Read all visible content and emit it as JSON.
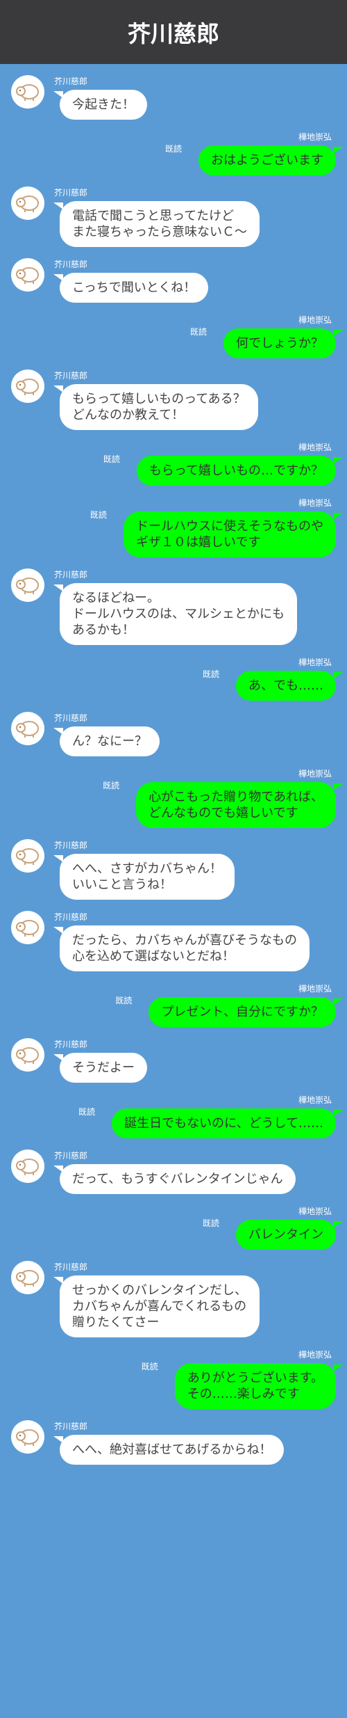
{
  "header": {
    "title": "芥川慈郎"
  },
  "read_label": "既読",
  "messages": [
    {
      "side": "left",
      "sender": "芥川慈郎",
      "text": "今起きた！"
    },
    {
      "side": "right",
      "sender": "樺地崇弘",
      "text": "おはようございます"
    },
    {
      "side": "left",
      "sender": "芥川慈郎",
      "text": "電話で聞こうと思ってたけど\nまた寝ちゃったら意味ないＣ〜"
    },
    {
      "side": "left",
      "sender": "芥川慈郎",
      "text": "こっちで聞いとくね！"
    },
    {
      "side": "right",
      "sender": "樺地崇弘",
      "text": "何でしょうか？"
    },
    {
      "side": "left",
      "sender": "芥川慈郎",
      "text": "もらって嬉しいものってある？\nどんなのか教えて！"
    },
    {
      "side": "right",
      "sender": "樺地崇弘",
      "text": "もらって嬉しいもの…ですか？"
    },
    {
      "side": "right",
      "sender": "樺地崇弘",
      "text": "ドールハウスに使えそうなものや\nギザ１０は嬉しいです"
    },
    {
      "side": "left",
      "sender": "芥川慈郎",
      "text": "なるほどねー。\nドールハウスのは、マルシェとかにも\nあるかも！"
    },
    {
      "side": "right",
      "sender": "樺地崇弘",
      "text": "あ、でも……"
    },
    {
      "side": "left",
      "sender": "芥川慈郎",
      "text": "ん？なにー？"
    },
    {
      "side": "right",
      "sender": "樺地崇弘",
      "text": "心がこもった贈り物であれば、\nどんなものでも嬉しいです"
    },
    {
      "side": "left",
      "sender": "芥川慈郎",
      "text": "へへ、さすがカバちゃん！\nいいこと言うね！"
    },
    {
      "side": "left",
      "sender": "芥川慈郎",
      "text": "だったら、カバちゃんが喜びそうなもの\n心を込めて選ばないとだね！"
    },
    {
      "side": "right",
      "sender": "樺地崇弘",
      "text": "プレゼント、自分にですか？"
    },
    {
      "side": "left",
      "sender": "芥川慈郎",
      "text": "そうだよー"
    },
    {
      "side": "right",
      "sender": "樺地崇弘",
      "text": "誕生日でもないのに、どうして……"
    },
    {
      "side": "left",
      "sender": "芥川慈郎",
      "text": "だって、もうすぐバレンタインじゃん"
    },
    {
      "side": "right",
      "sender": "樺地崇弘",
      "text": "バレンタイン"
    },
    {
      "side": "left",
      "sender": "芥川慈郎",
      "text": "せっかくのバレンタインだし、\nカバちゃんが喜んでくれるもの\n贈りたくてさー"
    },
    {
      "side": "right",
      "sender": "樺地崇弘",
      "text": "ありがとうございます。\nその……楽しみです"
    },
    {
      "side": "left",
      "sender": "芥川慈郎",
      "text": "へへ、絶対喜ばせてあげるからね！"
    }
  ]
}
